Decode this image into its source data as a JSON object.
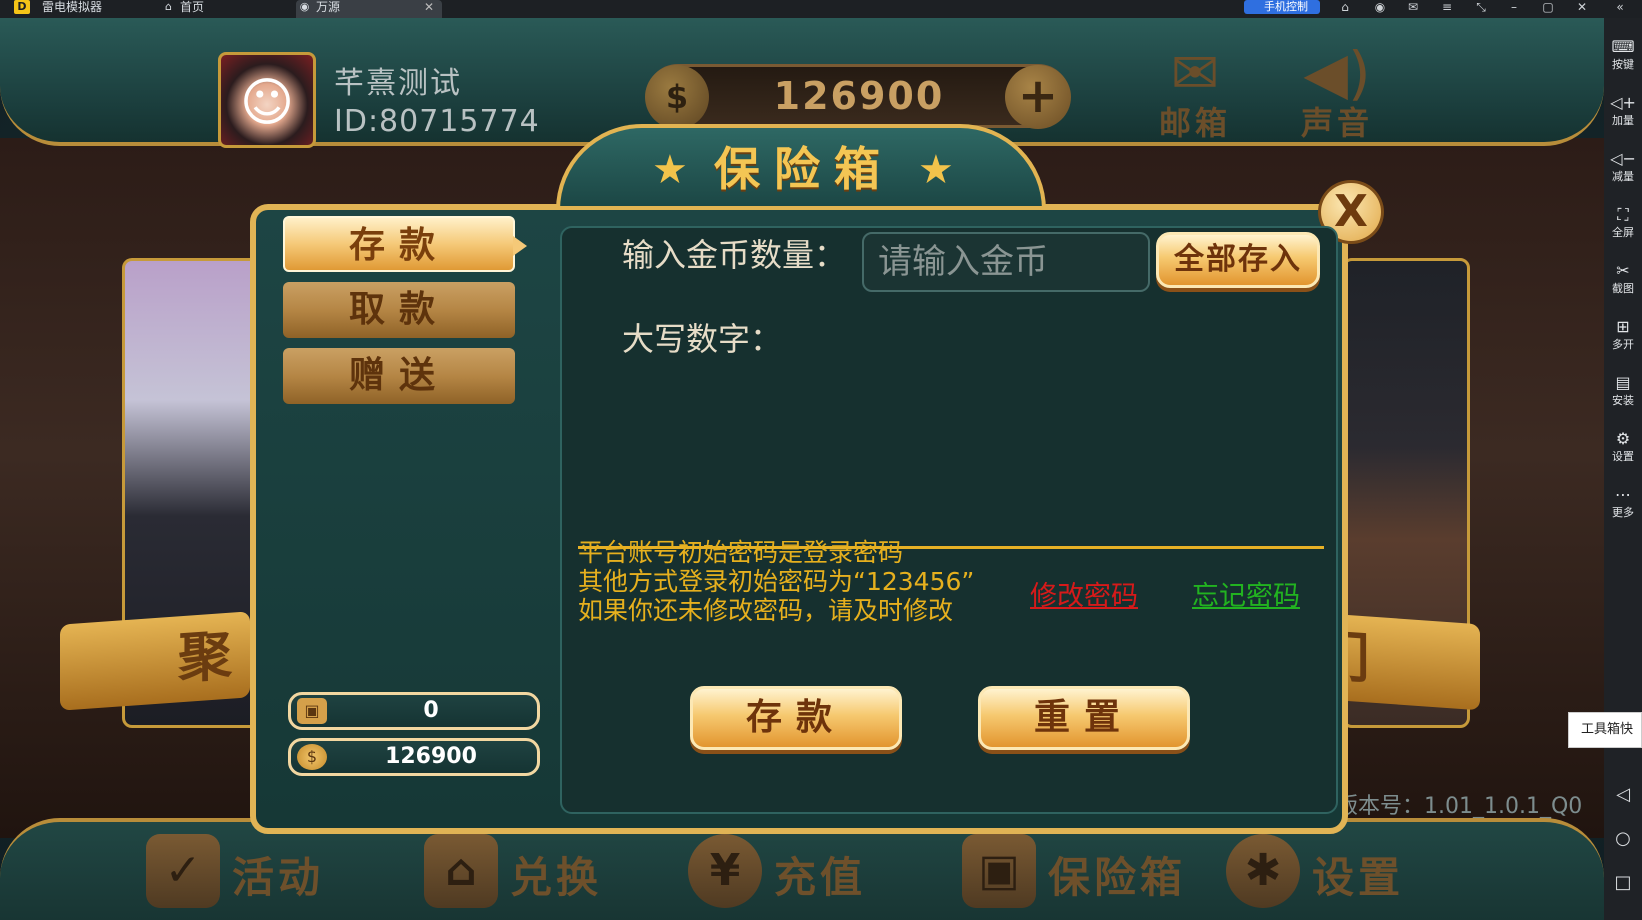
{
  "emulator": {
    "app_name": "雷电模拟器",
    "tabs": [
      {
        "label": "首页",
        "icon": "home-icon"
      },
      {
        "label": "万源",
        "icon": "app-icon"
      }
    ],
    "phone_control_label": "手机控制",
    "sidebar": [
      {
        "label": "按键",
        "icon": "keyboard-icon"
      },
      {
        "label": "加量",
        "icon": "volume-up-icon"
      },
      {
        "label": "减量",
        "icon": "volume-down-icon"
      },
      {
        "label": "全屏",
        "icon": "fullscreen-icon"
      },
      {
        "label": "截图",
        "icon": "scissors-icon"
      },
      {
        "label": "多开",
        "icon": "multi-instance-icon"
      },
      {
        "label": "安装",
        "icon": "apk-install-icon"
      },
      {
        "label": "设置",
        "icon": "gear-icon"
      },
      {
        "label": "更多",
        "icon": "more-icon"
      }
    ],
    "toolbox_tip": "工具箱快",
    "nav": [
      "back-icon",
      "home-circle-icon",
      "recents-square-icon"
    ]
  },
  "game": {
    "user": {
      "nickname": "芊熹测试",
      "id": "ID:80715774"
    },
    "coins": "126900",
    "top_buttons": [
      {
        "label": "邮箱",
        "icon": "mail-icon"
      },
      {
        "label": "声音",
        "icon": "speaker-icon"
      }
    ],
    "banner_left": "聚",
    "banner_right": "门",
    "version": "版本号：1.01_1.0.1_Q0",
    "bottom_nav": [
      {
        "label": "活动",
        "icon": "checkbox-icon"
      },
      {
        "label": "兑换",
        "icon": "shop-icon"
      },
      {
        "label": "充值",
        "icon": "money-bag-icon"
      },
      {
        "label": "保险箱",
        "icon": "briefcase-icon"
      },
      {
        "label": "设置",
        "icon": "gear-icon"
      }
    ]
  },
  "safe": {
    "title": "保险箱",
    "close_label": "X",
    "tabs": [
      "存款",
      "取款",
      "赠送"
    ],
    "active_tab": "存款",
    "safe_balance": "0",
    "wallet_balance": "126900",
    "amount_label": "输入金币数量：",
    "amount_placeholder": "请输入金币",
    "deposit_all_label": "全部存入",
    "uppercase_label": "大写数字：",
    "notice_lines": [
      "平台账号初始密码是登录密码",
      "其他方式登录初始密码为“123456”",
      "如果你还未修改密码，请及时修改"
    ],
    "change_password": "修改密码",
    "forgot_password": "忘记密码",
    "deposit_button": "存款",
    "reset_button": "重置"
  },
  "colors": {
    "gold": "#e1b455",
    "panel": "#1d4544",
    "notice": "#e6b01e",
    "link_red": "#d61a1a",
    "link_green": "#22b320"
  }
}
